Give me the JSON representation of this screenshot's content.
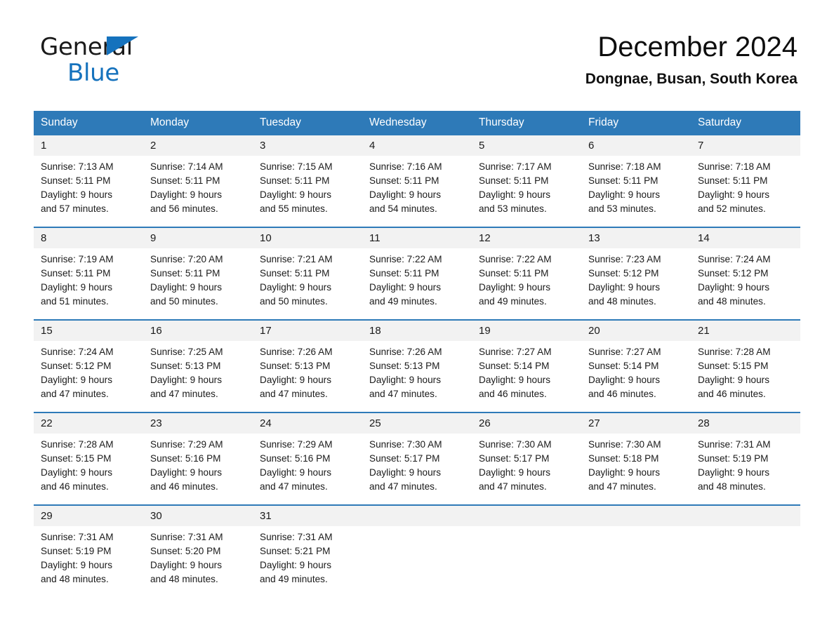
{
  "brand": {
    "name_part1": "General",
    "name_part2": "Blue",
    "accent_color": "#1572bd"
  },
  "header": {
    "title": "December 2024",
    "location": "Dongnae, Busan, South Korea"
  },
  "calendar": {
    "header_bg": "#2e7ab8",
    "date_band_bg": "#f2f2f2",
    "weekdays": [
      "Sunday",
      "Monday",
      "Tuesday",
      "Wednesday",
      "Thursday",
      "Friday",
      "Saturday"
    ],
    "weeks": [
      [
        {
          "day": "1",
          "sunrise": "Sunrise: 7:13 AM",
          "sunset": "Sunset: 5:11 PM",
          "daylight1": "Daylight: 9 hours",
          "daylight2": "and 57 minutes."
        },
        {
          "day": "2",
          "sunrise": "Sunrise: 7:14 AM",
          "sunset": "Sunset: 5:11 PM",
          "daylight1": "Daylight: 9 hours",
          "daylight2": "and 56 minutes."
        },
        {
          "day": "3",
          "sunrise": "Sunrise: 7:15 AM",
          "sunset": "Sunset: 5:11 PM",
          "daylight1": "Daylight: 9 hours",
          "daylight2": "and 55 minutes."
        },
        {
          "day": "4",
          "sunrise": "Sunrise: 7:16 AM",
          "sunset": "Sunset: 5:11 PM",
          "daylight1": "Daylight: 9 hours",
          "daylight2": "and 54 minutes."
        },
        {
          "day": "5",
          "sunrise": "Sunrise: 7:17 AM",
          "sunset": "Sunset: 5:11 PM",
          "daylight1": "Daylight: 9 hours",
          "daylight2": "and 53 minutes."
        },
        {
          "day": "6",
          "sunrise": "Sunrise: 7:18 AM",
          "sunset": "Sunset: 5:11 PM",
          "daylight1": "Daylight: 9 hours",
          "daylight2": "and 53 minutes."
        },
        {
          "day": "7",
          "sunrise": "Sunrise: 7:18 AM",
          "sunset": "Sunset: 5:11 PM",
          "daylight1": "Daylight: 9 hours",
          "daylight2": "and 52 minutes."
        }
      ],
      [
        {
          "day": "8",
          "sunrise": "Sunrise: 7:19 AM",
          "sunset": "Sunset: 5:11 PM",
          "daylight1": "Daylight: 9 hours",
          "daylight2": "and 51 minutes."
        },
        {
          "day": "9",
          "sunrise": "Sunrise: 7:20 AM",
          "sunset": "Sunset: 5:11 PM",
          "daylight1": "Daylight: 9 hours",
          "daylight2": "and 50 minutes."
        },
        {
          "day": "10",
          "sunrise": "Sunrise: 7:21 AM",
          "sunset": "Sunset: 5:11 PM",
          "daylight1": "Daylight: 9 hours",
          "daylight2": "and 50 minutes."
        },
        {
          "day": "11",
          "sunrise": "Sunrise: 7:22 AM",
          "sunset": "Sunset: 5:11 PM",
          "daylight1": "Daylight: 9 hours",
          "daylight2": "and 49 minutes."
        },
        {
          "day": "12",
          "sunrise": "Sunrise: 7:22 AM",
          "sunset": "Sunset: 5:11 PM",
          "daylight1": "Daylight: 9 hours",
          "daylight2": "and 49 minutes."
        },
        {
          "day": "13",
          "sunrise": "Sunrise: 7:23 AM",
          "sunset": "Sunset: 5:12 PM",
          "daylight1": "Daylight: 9 hours",
          "daylight2": "and 48 minutes."
        },
        {
          "day": "14",
          "sunrise": "Sunrise: 7:24 AM",
          "sunset": "Sunset: 5:12 PM",
          "daylight1": "Daylight: 9 hours",
          "daylight2": "and 48 minutes."
        }
      ],
      [
        {
          "day": "15",
          "sunrise": "Sunrise: 7:24 AM",
          "sunset": "Sunset: 5:12 PM",
          "daylight1": "Daylight: 9 hours",
          "daylight2": "and 47 minutes."
        },
        {
          "day": "16",
          "sunrise": "Sunrise: 7:25 AM",
          "sunset": "Sunset: 5:13 PM",
          "daylight1": "Daylight: 9 hours",
          "daylight2": "and 47 minutes."
        },
        {
          "day": "17",
          "sunrise": "Sunrise: 7:26 AM",
          "sunset": "Sunset: 5:13 PM",
          "daylight1": "Daylight: 9 hours",
          "daylight2": "and 47 minutes."
        },
        {
          "day": "18",
          "sunrise": "Sunrise: 7:26 AM",
          "sunset": "Sunset: 5:13 PM",
          "daylight1": "Daylight: 9 hours",
          "daylight2": "and 47 minutes."
        },
        {
          "day": "19",
          "sunrise": "Sunrise: 7:27 AM",
          "sunset": "Sunset: 5:14 PM",
          "daylight1": "Daylight: 9 hours",
          "daylight2": "and 46 minutes."
        },
        {
          "day": "20",
          "sunrise": "Sunrise: 7:27 AM",
          "sunset": "Sunset: 5:14 PM",
          "daylight1": "Daylight: 9 hours",
          "daylight2": "and 46 minutes."
        },
        {
          "day": "21",
          "sunrise": "Sunrise: 7:28 AM",
          "sunset": "Sunset: 5:15 PM",
          "daylight1": "Daylight: 9 hours",
          "daylight2": "and 46 minutes."
        }
      ],
      [
        {
          "day": "22",
          "sunrise": "Sunrise: 7:28 AM",
          "sunset": "Sunset: 5:15 PM",
          "daylight1": "Daylight: 9 hours",
          "daylight2": "and 46 minutes."
        },
        {
          "day": "23",
          "sunrise": "Sunrise: 7:29 AM",
          "sunset": "Sunset: 5:16 PM",
          "daylight1": "Daylight: 9 hours",
          "daylight2": "and 46 minutes."
        },
        {
          "day": "24",
          "sunrise": "Sunrise: 7:29 AM",
          "sunset": "Sunset: 5:16 PM",
          "daylight1": "Daylight: 9 hours",
          "daylight2": "and 47 minutes."
        },
        {
          "day": "25",
          "sunrise": "Sunrise: 7:30 AM",
          "sunset": "Sunset: 5:17 PM",
          "daylight1": "Daylight: 9 hours",
          "daylight2": "and 47 minutes."
        },
        {
          "day": "26",
          "sunrise": "Sunrise: 7:30 AM",
          "sunset": "Sunset: 5:17 PM",
          "daylight1": "Daylight: 9 hours",
          "daylight2": "and 47 minutes."
        },
        {
          "day": "27",
          "sunrise": "Sunrise: 7:30 AM",
          "sunset": "Sunset: 5:18 PM",
          "daylight1": "Daylight: 9 hours",
          "daylight2": "and 47 minutes."
        },
        {
          "day": "28",
          "sunrise": "Sunrise: 7:31 AM",
          "sunset": "Sunset: 5:19 PM",
          "daylight1": "Daylight: 9 hours",
          "daylight2": "and 48 minutes."
        }
      ],
      [
        {
          "day": "29",
          "sunrise": "Sunrise: 7:31 AM",
          "sunset": "Sunset: 5:19 PM",
          "daylight1": "Daylight: 9 hours",
          "daylight2": "and 48 minutes."
        },
        {
          "day": "30",
          "sunrise": "Sunrise: 7:31 AM",
          "sunset": "Sunset: 5:20 PM",
          "daylight1": "Daylight: 9 hours",
          "daylight2": "and 48 minutes."
        },
        {
          "day": "31",
          "sunrise": "Sunrise: 7:31 AM",
          "sunset": "Sunset: 5:21 PM",
          "daylight1": "Daylight: 9 hours",
          "daylight2": "and 49 minutes."
        },
        {
          "day": "",
          "sunrise": "",
          "sunset": "",
          "daylight1": "",
          "daylight2": ""
        },
        {
          "day": "",
          "sunrise": "",
          "sunset": "",
          "daylight1": "",
          "daylight2": ""
        },
        {
          "day": "",
          "sunrise": "",
          "sunset": "",
          "daylight1": "",
          "daylight2": ""
        },
        {
          "day": "",
          "sunrise": "",
          "sunset": "",
          "daylight1": "",
          "daylight2": ""
        }
      ]
    ]
  }
}
